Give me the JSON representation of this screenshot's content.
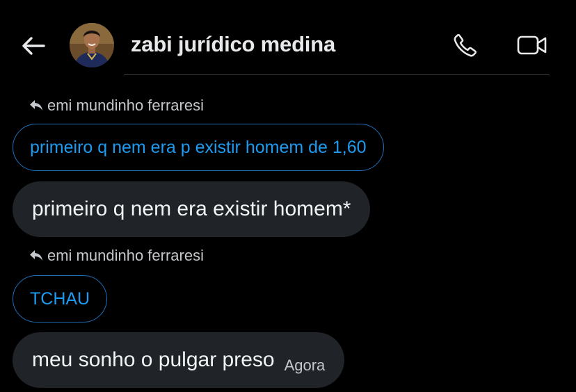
{
  "header": {
    "back_icon": "arrow-left-icon",
    "contact_name": "zabi jurídico medina",
    "call_icon": "phone-icon",
    "video_icon": "video-camera-icon"
  },
  "colors": {
    "background": "#000000",
    "bubble": "#202327",
    "accent": "#1d9bf0",
    "quoted_border": "#1d6fb8",
    "divider": "#2f3336"
  },
  "messages": [
    {
      "reply_to": "emi mundinho ferraresi",
      "quoted_text": "primeiro q nem era p existir homem de 1,60",
      "text": "primeiro q nem era existir homem*"
    },
    {
      "reply_to": "emi mundinho ferraresi",
      "quoted_text": "TCHAU",
      "text": "meu sonho o pulgar preso",
      "timestamp": "Agora"
    }
  ]
}
